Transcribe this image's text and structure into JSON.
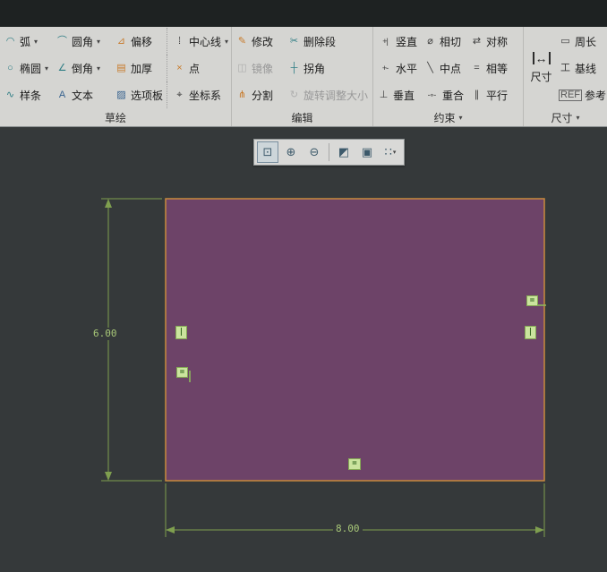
{
  "ui": {
    "dropdown_arrow": "▾"
  },
  "ribbon": {
    "sketch": {
      "label": "草绘",
      "items": {
        "arc": {
          "label": "弧",
          "icon": "◠"
        },
        "fillet": {
          "label": "圆角",
          "icon": "⌒"
        },
        "offset": {
          "label": "偏移",
          "icon": "⊿"
        },
        "centerline": {
          "label": "中心线",
          "icon": "⁞"
        },
        "ellipse": {
          "label": "椭圆",
          "icon": "○"
        },
        "chamfer": {
          "label": "倒角",
          "icon": "∠"
        },
        "thicken": {
          "label": "加厚",
          "icon": "▤"
        },
        "point": {
          "label": "点",
          "icon": "×"
        },
        "spline": {
          "label": "样条",
          "icon": "∿"
        },
        "text": {
          "label": "文本",
          "icon": "A"
        },
        "palette": {
          "label": "选项板",
          "icon": "▨"
        },
        "csys": {
          "label": "坐标系",
          "icon": "⌖"
        }
      }
    },
    "edit": {
      "label": "编辑",
      "items": {
        "modify": {
          "label": "修改",
          "icon": "✎"
        },
        "delete_segment": {
          "label": "删除段",
          "icon": "✂"
        },
        "mirror": {
          "label": "镜像",
          "icon": "◫"
        },
        "corner": {
          "label": "拐角",
          "icon": "┼"
        },
        "divide": {
          "label": "分割",
          "icon": "⋔"
        },
        "rotate_resize": {
          "label": "旋转调整大小",
          "icon": "↻"
        }
      }
    },
    "constrain": {
      "label": "约束",
      "items": {
        "vertical": {
          "label": "竖直",
          "icon": "+|"
        },
        "tangent": {
          "label": "相切",
          "icon": "⌀"
        },
        "symmetric": {
          "label": "对称",
          "icon": "⇄"
        },
        "horizontal": {
          "label": "水平",
          "icon": "+-"
        },
        "midpoint": {
          "label": "中点",
          "icon": "╲"
        },
        "equal": {
          "label": "相等",
          "icon": "="
        },
        "perpendicular": {
          "label": "垂直",
          "icon": "⊥"
        },
        "coincident": {
          "label": "重合",
          "icon": "-∘-"
        },
        "parallel": {
          "label": "平行",
          "icon": "∥"
        }
      }
    },
    "dimension": {
      "label": "尺寸",
      "items": {
        "dimension": {
          "label": "尺寸",
          "icon": "↔"
        },
        "perimeter": {
          "label": "周长",
          "icon": "▭"
        },
        "baseline": {
          "label": "基线",
          "icon": "工"
        },
        "reference": {
          "label": "参考",
          "icon": "REF"
        }
      }
    }
  },
  "viewbar": {
    "buttons": [
      {
        "name": "box-zoom",
        "icon": "⊡"
      },
      {
        "name": "zoom-in",
        "icon": "⊕"
      },
      {
        "name": "zoom-out",
        "icon": "⊖"
      },
      {
        "name": "display-style",
        "icon": "◩"
      },
      {
        "name": "display-style-2",
        "icon": "▣"
      },
      {
        "name": "grid-display",
        "icon": "∷"
      }
    ]
  },
  "canvas": {
    "width_dim": "8.00",
    "height_dim": "6.00",
    "markers": [
      {
        "type": "vertical-constraint",
        "glyph": "|"
      },
      {
        "type": "equal-constraint",
        "glyph": "="
      },
      {
        "type": "equal-constraint",
        "glyph": "="
      },
      {
        "type": "vertical-constraint",
        "glyph": "|"
      },
      {
        "type": "equal-constraint",
        "glyph": "="
      }
    ]
  },
  "colors": {
    "canvas_bg": "#35393a",
    "rect_fill": "#6d4368",
    "rect_stroke": "#c98a3c",
    "dim_line": "#7f9f4f",
    "dim_text": "#a8c878",
    "marker_bg": "#cbe49e",
    "marker_border": "#85aa55",
    "marker_text": "#2f641c"
  }
}
